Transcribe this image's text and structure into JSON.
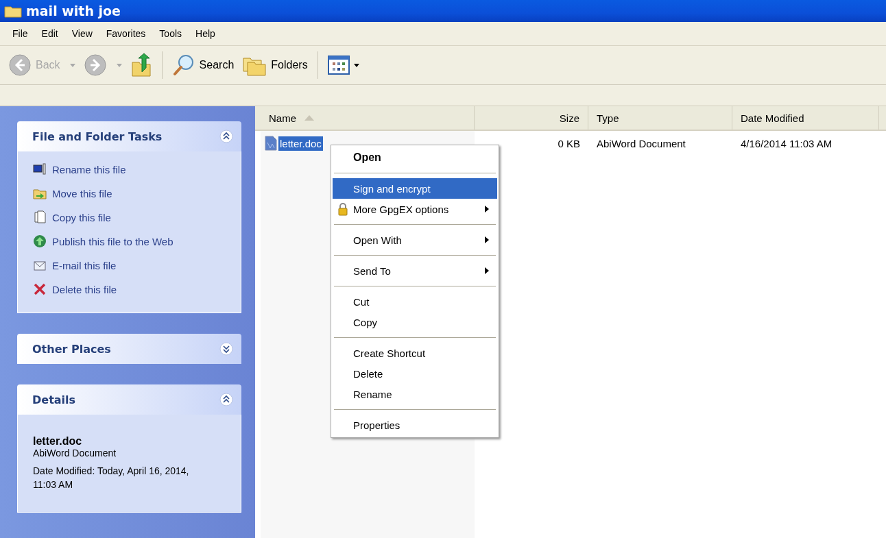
{
  "window": {
    "title": "mail with joe"
  },
  "menu_bar": [
    "File",
    "Edit",
    "View",
    "Favorites",
    "Tools",
    "Help"
  ],
  "toolbar": [
    {
      "kind": "back",
      "label": "Back",
      "disabled": true
    },
    {
      "kind": "forward",
      "disabled": true
    },
    {
      "kind": "up"
    },
    {
      "kind": "separator"
    },
    {
      "kind": "search",
      "label": "Search",
      "disabled": false
    },
    {
      "kind": "folders",
      "label": "Folders",
      "disabled": false
    },
    {
      "kind": "separator"
    },
    {
      "kind": "views"
    }
  ],
  "sidebar": {
    "panels": [
      {
        "kind": "tasks",
        "title": "File and Folder Tasks",
        "expanded": true,
        "items": [
          {
            "kind": "rename",
            "label": "Rename this file"
          },
          {
            "kind": "move",
            "label": "Move this file"
          },
          {
            "kind": "copy",
            "label": "Copy this file"
          },
          {
            "kind": "publish",
            "label": "Publish this file to the Web"
          },
          {
            "kind": "email",
            "label": "E-mail this file"
          },
          {
            "kind": "delete",
            "label": "Delete this file"
          }
        ]
      },
      {
        "title": "Other Places",
        "expanded": false
      },
      {
        "kind": "details",
        "title": "Details",
        "expanded": true,
        "name": "letter.doc",
        "type": "AbiWord Document",
        "modified": "Date Modified: Today, April 16, 2014, 11:03 AM"
      }
    ]
  },
  "table": {
    "columns": [
      {
        "label": "Name",
        "sorted": true
      },
      {
        "label": "Size",
        "sorted": false
      },
      {
        "label": "Type",
        "sorted": false
      },
      {
        "label": "Date Modified",
        "sorted": false
      }
    ],
    "rows": [
      {
        "selected": true,
        "cells": [
          "letter.doc",
          "0 KB",
          "AbiWord Document",
          "4/16/2014 11:03 AM"
        ]
      }
    ]
  },
  "context_menu": [
    {
      "kind": "item",
      "label": "Open",
      "bold": true,
      "selected": false,
      "submenu": false
    },
    {
      "kind": "separator"
    },
    {
      "kind": "item",
      "label": "Sign and encrypt",
      "bold": false,
      "selected": true,
      "submenu": false
    },
    {
      "kind": "lock_item",
      "label": "More GpgEX options",
      "bold": false,
      "selected": false,
      "submenu": true
    },
    {
      "kind": "separator"
    },
    {
      "kind": "item",
      "label": "Open With",
      "bold": false,
      "selected": false,
      "submenu": true
    },
    {
      "kind": "separator"
    },
    {
      "kind": "item",
      "label": "Send To",
      "bold": false,
      "selected": false,
      "submenu": true
    },
    {
      "kind": "separator"
    },
    {
      "kind": "item",
      "label": "Cut",
      "bold": false,
      "selected": false,
      "submenu": false
    },
    {
      "kind": "item",
      "label": "Copy",
      "bold": false,
      "selected": false,
      "submenu": false
    },
    {
      "kind": "separator"
    },
    {
      "kind": "item",
      "label": "Create Shortcut",
      "bold": false,
      "selected": false,
      "submenu": false
    },
    {
      "kind": "item",
      "label": "Delete",
      "bold": false,
      "selected": false,
      "submenu": false
    },
    {
      "kind": "item",
      "label": "Rename",
      "bold": false,
      "selected": false,
      "submenu": false
    },
    {
      "kind": "separator"
    },
    {
      "kind": "item",
      "label": "Properties",
      "bold": false,
      "selected": false,
      "submenu": false
    }
  ]
}
